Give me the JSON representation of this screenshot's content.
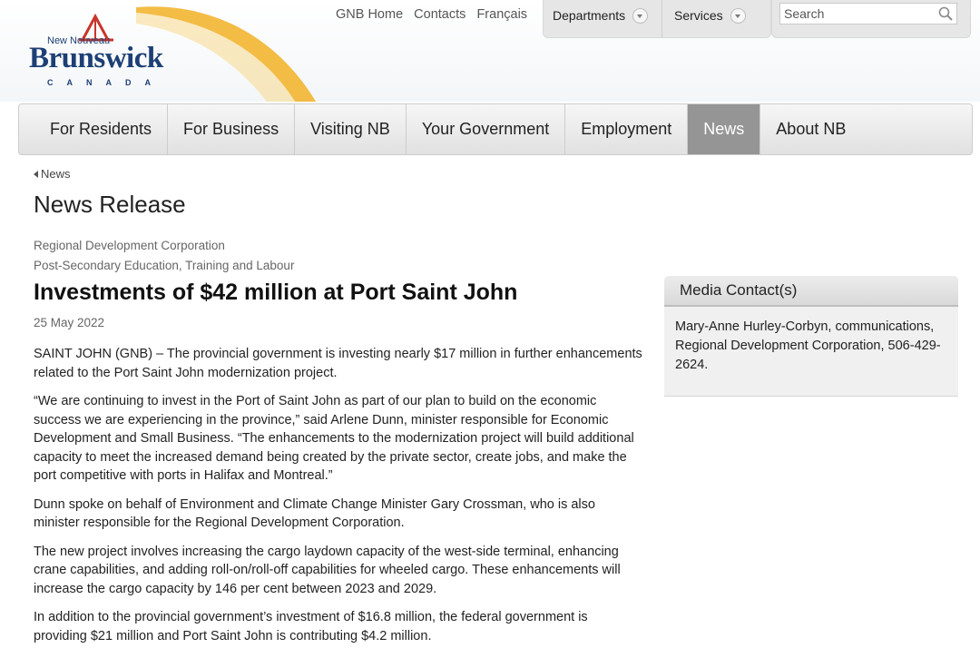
{
  "header": {
    "logo": {
      "new_nouveau": "New Nouveau",
      "wordmark": "Brunswick",
      "canada": "CANADA"
    },
    "top_links": [
      "GNB Home",
      "Contacts",
      "Français"
    ],
    "departments_label": "Departments",
    "services_label": "Services",
    "search_placeholder": "Search"
  },
  "nav": {
    "items": [
      "For Residents",
      "For Business",
      "Visiting NB",
      "Your Government",
      "Employment",
      "News",
      "About NB"
    ],
    "active": "News"
  },
  "breadcrumb": "News",
  "page_heading": "News Release",
  "departments": [
    "Regional Development Corporation",
    "Post-Secondary Education, Training and Labour"
  ],
  "article": {
    "title": "Investments of $42 million at Port Saint John",
    "date": "25 May 2022",
    "paragraphs": [
      "SAINT JOHN (GNB) – The provincial government is investing nearly $17 million in further enhancements related to the Port Saint John modernization project.",
      "“We are continuing to invest in the Port of Saint John as part of our plan to build on the economic success we are experiencing in the province,” said Arlene Dunn, minister responsible for Economic Development and Small Business. “The enhancements to the modernization project will build additional capacity to meet the increased demand being created by the private sector, create jobs, and make the port competitive with ports in Halifax and Montreal.”",
      "Dunn spoke on behalf of Environment and Climate Change Minister Gary Crossman, who is also minister responsible for the Regional Development Corporation.",
      "The new project involves increasing the cargo laydown capacity of the west-side terminal, enhancing crane capabilities, and adding roll-on/roll-off capabilities for wheeled cargo. These enhancements will increase the cargo capacity by 146 per cent between 2023 and 2029.",
      "In addition to the provincial government’s investment of $16.8 million, the federal government is providing $21 million and Port Saint John is contributing $4.2 million."
    ]
  },
  "media_contact": {
    "heading": "Media Contact(s)",
    "body": "Mary-Anne Hurley-Corbyn, communications, Regional Development Corporation, 506-429-2624."
  },
  "colors": {
    "brand_blue": "#1d3f75",
    "swoosh_yellow": "#f2b531",
    "logo_red": "#c8352b",
    "nav_active": "#959595"
  }
}
